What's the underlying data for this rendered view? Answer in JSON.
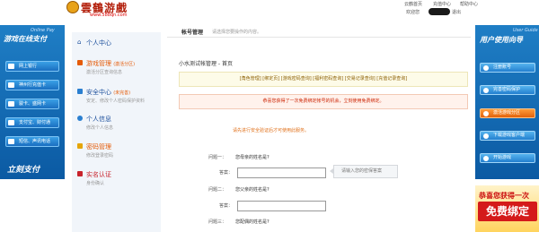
{
  "header": {
    "logo_text": "雲鶴游戲",
    "logo_url": "www.588qn.com",
    "links": [
      "云鶴首页",
      "充值中心",
      "帮助中心"
    ],
    "welcome": "欢迎您",
    "logout": "退出"
  },
  "left_banner": {
    "en_title": "Online Pay",
    "title": "游戏在线支付",
    "items": [
      "网上银行",
      "神州行充值卡",
      "骏卡、盛网卡",
      "支付宝、财付通",
      "短信、声讯电话"
    ],
    "bottom_text": "立刻支付"
  },
  "right_banner": {
    "en_title": "User Guide",
    "title": "用户使用向导",
    "items": [
      "注册账号",
      "完善密码保护",
      "激活游戏分区",
      "下载游戏客户端",
      "开始游戏"
    ]
  },
  "promo": {
    "top": "恭喜您获得一次",
    "big": "免费绑定"
  },
  "sidebar": {
    "user_center": "个人中心",
    "sections": [
      {
        "title": "游戏管理",
        "extra": "(激活分区)",
        "sub": "激活分区查询信息"
      },
      {
        "title": "安全中心",
        "extra": "(未完善)",
        "sub": "安定、修改个人密码保护资料"
      },
      {
        "title": "个人信息",
        "extra": "",
        "sub": "修改个人信息"
      },
      {
        "title": "密码管理",
        "extra": "",
        "sub": "修改登录密码"
      },
      {
        "title": "实名认证",
        "extra": "",
        "sub": "身份确认"
      }
    ]
  },
  "main": {
    "crumb_title": "帐号管理",
    "crumb_hint": "请选择您要操作的内容。",
    "section_title": "小水测试帐管理 - 首页",
    "link_bar": "[角色管理] [绑定页] [游戏密码查询] [福利密码查询] [交易记录查询] [充值记录查询]",
    "warning": "恭喜您获得了一次免费绑定帐号的机会，立刻使用免费绑定。",
    "notice": "请先进行安全验证后才可使用此服务。",
    "questions": [
      {
        "label": "问题一：",
        "question": "您母亲的姓名是?",
        "answer_label": "答案："
      },
      {
        "label": "问题二：",
        "question": "您父亲的姓名是?",
        "answer_label": "答案："
      },
      {
        "label": "问题三：",
        "question": "您配偶的姓名是?",
        "answer_label": ""
      }
    ],
    "tooltip": "请输入您的密保答案"
  },
  "colors": {
    "banner_blue": "#1f7ec5",
    "warning_red": "#cc2200",
    "notice_orange": "#e0701a",
    "link_gold": "#8b5e00"
  }
}
